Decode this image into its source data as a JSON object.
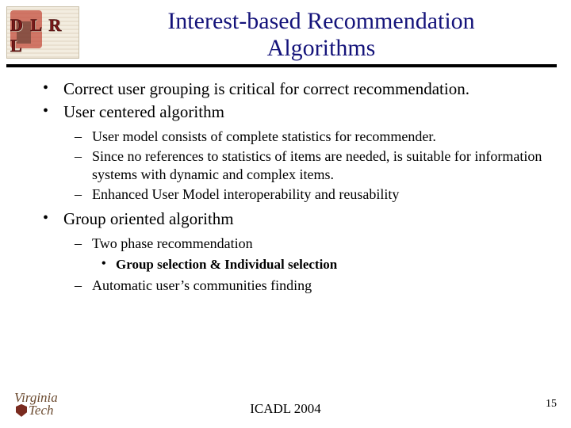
{
  "header": {
    "logo_text": "D L R L",
    "title_line1": "Interest-based Recommendation",
    "title_line2": "Algorithms"
  },
  "bullets": {
    "b1": "Correct user grouping is critical for correct recommendation.",
    "b2": "User centered algorithm",
    "b2_sub": {
      "s1": "User model consists of complete statistics for recommender.",
      "s2": "Since no references to statistics of items are needed, is suitable for information systems with dynamic and complex items.",
      "s3": "Enhanced User Model interoperability and reusability"
    },
    "b3": "Group oriented algorithm",
    "b3_sub": {
      "s1": "Two phase recommendation",
      "s1_sub": "Group selection & Individual selection",
      "s2": "Automatic user’s communities finding"
    }
  },
  "footer": {
    "vt_line1": "Virginia",
    "vt_line2": "Tech",
    "center": "ICADL 2004",
    "page": "15"
  }
}
